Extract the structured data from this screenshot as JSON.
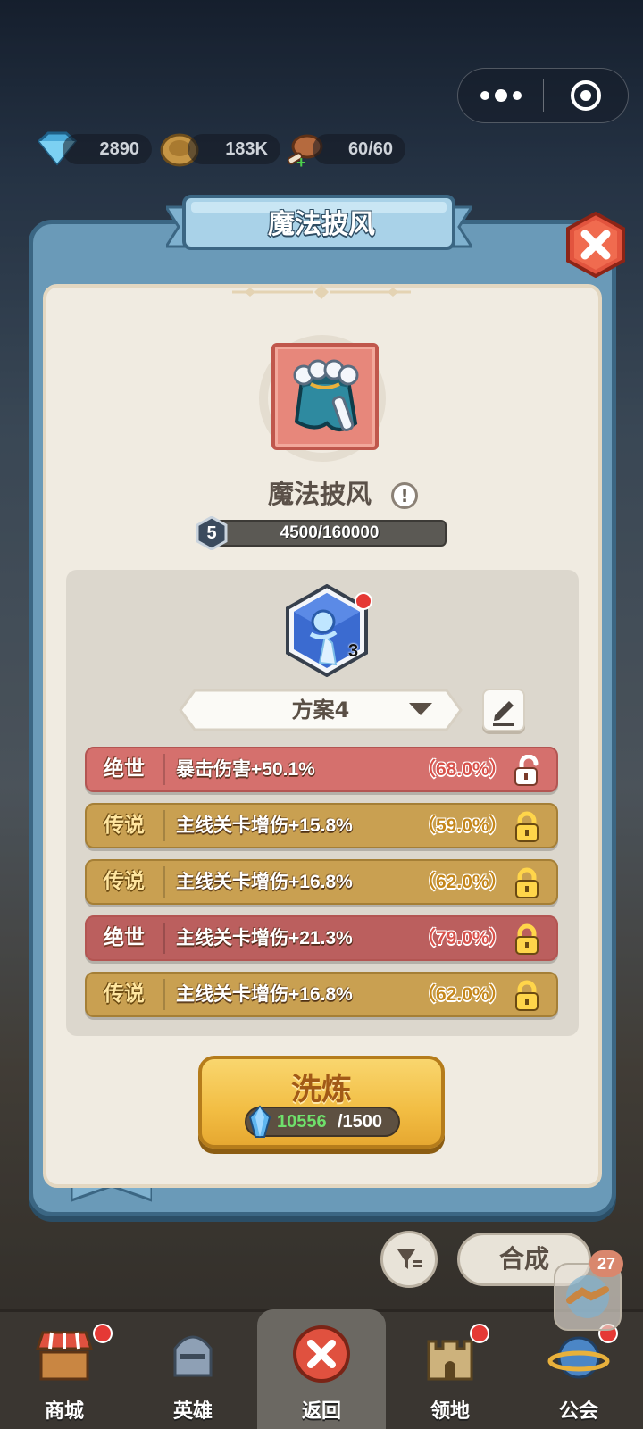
{
  "top_bar": {
    "resources": [
      {
        "icon": "diamond-icon",
        "value": "2890"
      },
      {
        "icon": "coin-icon",
        "value": "183K"
      },
      {
        "icon": "meat-stamina-icon",
        "value": "60/60"
      }
    ],
    "capsule": {
      "more_icon": "more-dots-icon",
      "close_icon": "target-circle-icon"
    }
  },
  "dialog": {
    "title": "魔法披风",
    "close_icon": "close-x-icon",
    "item": {
      "name": "魔法披风",
      "icon": "cloak-icon",
      "info_icon": "exclamation-icon",
      "level": "5",
      "exp_text": "4500/160000",
      "exp_progress": 0.028125
    },
    "gem": {
      "icon": "ice-gem-icon",
      "count": "3",
      "has_notification": true
    },
    "scheme": {
      "label": "方案4",
      "dropdown_icon": "triangle-down-icon",
      "edit_icon": "pencil-edit-icon"
    },
    "affixes": [
      {
        "tier": "绝世",
        "text": "暴击伤害+50.1%",
        "percent": "（68.0%）",
        "locked": false
      },
      {
        "tier": "传说",
        "text": "主线关卡增伤+15.8%",
        "percent": "（59.0%）",
        "locked": true
      },
      {
        "tier": "传说",
        "text": "主线关卡增伤+16.8%",
        "percent": "（62.0%）",
        "locked": true
      },
      {
        "tier": "绝世",
        "text": "主线关卡增伤+21.3%",
        "percent": "（79.0%）",
        "locked": true
      },
      {
        "tier": "传说",
        "text": "主线关卡增伤+16.8%",
        "percent": "（62.0%）",
        "locked": true
      }
    ],
    "wash_button": {
      "label": "洗炼",
      "cost_have": "10556",
      "cost_need": "/1500",
      "cost_icon": "crystal-icon"
    }
  },
  "below_dialog": {
    "filter_icon": "filter-icon",
    "merge_label": "合成",
    "float_badge_count": "27",
    "float_icon": "handshake-icon"
  },
  "colors": {
    "mythic_red": "#d5706d",
    "legend_gold": "#c9a051",
    "panel_blue": "#6a9ab8",
    "notify_red": "#e53935"
  },
  "bottom_nav": [
    {
      "label": "商城",
      "icon": "shop-stall-icon",
      "dot": true
    },
    {
      "label": "英雄",
      "icon": "knight-helmet-icon",
      "dot": false
    },
    {
      "label": "返回",
      "icon": "close-x-icon",
      "active": true
    },
    {
      "label": "领地",
      "icon": "castle-icon",
      "dot": true
    },
    {
      "label": "公会",
      "icon": "guild-planet-icon",
      "dot": true
    }
  ]
}
